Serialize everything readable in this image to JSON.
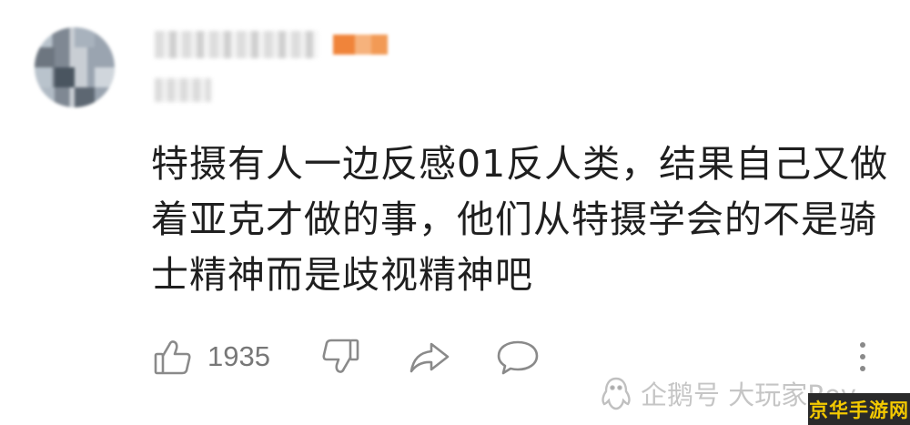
{
  "comment": {
    "lines": [
      "特摄有人一边反感01反人类，结果自己又做",
      "着亚克才做的事，他们从特摄学会的不是骑",
      "士精神而是歧视精神吧"
    ]
  },
  "actions": {
    "like_count": "1935",
    "icons": [
      "thumbs-up-icon",
      "thumbs-down-icon",
      "share-icon",
      "reply-icon",
      "more-vertical-icon"
    ]
  },
  "watermark": {
    "text": "企鹅号 大玩家Roy",
    "icon": "penguin-icon"
  },
  "site_badge": {
    "text": "京华手游网"
  },
  "colors": {
    "text": "#1f1f1f",
    "muted": "#777777",
    "icon": "#8a8a8a",
    "badge_bg": "#2a2a2a",
    "badge_text": "#f3c900",
    "level_badge": "#f0843a"
  }
}
